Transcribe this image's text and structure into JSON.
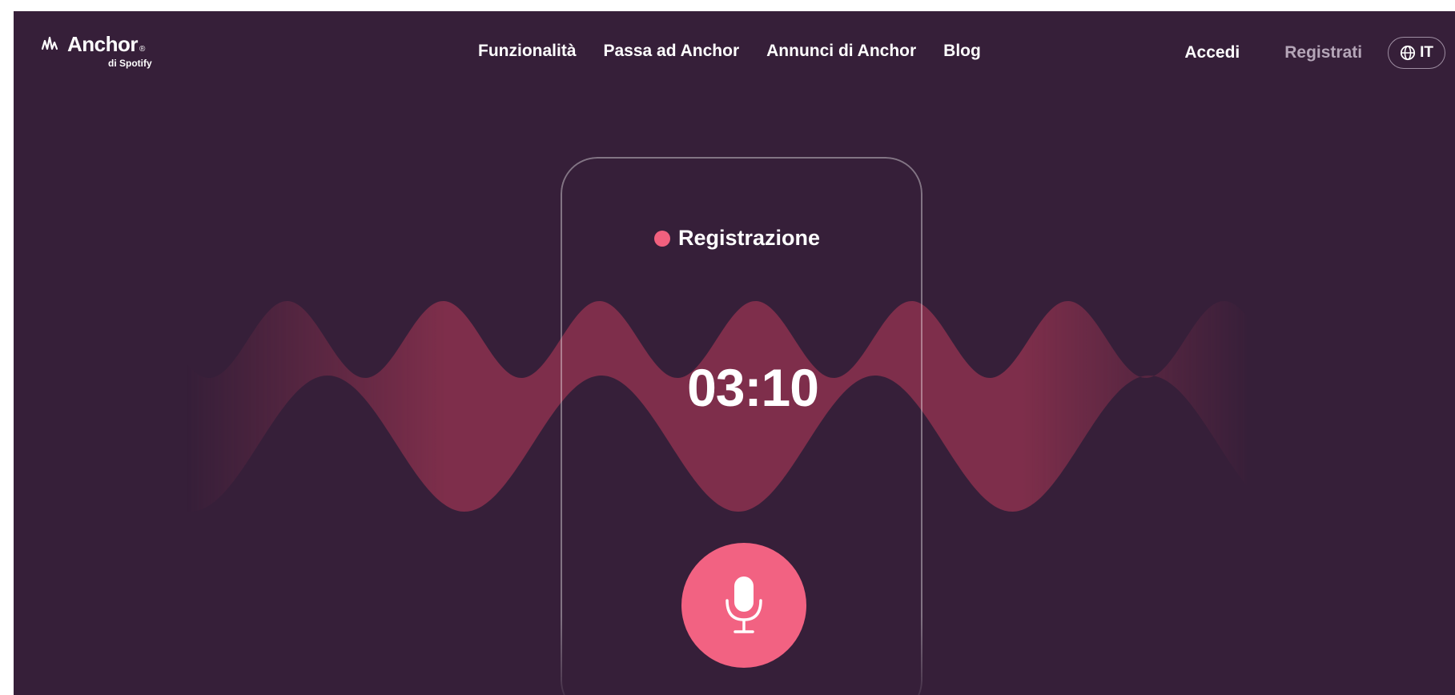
{
  "brand": {
    "name": "Anchor",
    "registered_mark": "®",
    "tagline": "di Spotify"
  },
  "nav": {
    "items": [
      {
        "label": "Funzionalità"
      },
      {
        "label": "Passa ad Anchor"
      },
      {
        "label": "Annunci di Anchor"
      },
      {
        "label": "Blog"
      }
    ]
  },
  "account": {
    "login_label": "Accedi",
    "signup_label": "Registrati"
  },
  "language": {
    "icon": "globe-icon",
    "code": "IT"
  },
  "recorder": {
    "status_label": "Registrazione",
    "elapsed_time": "03:10",
    "record_icon": "microphone-icon"
  },
  "colors": {
    "background": "#361f39",
    "accent": "#f26282",
    "wave": "#9a3452"
  }
}
